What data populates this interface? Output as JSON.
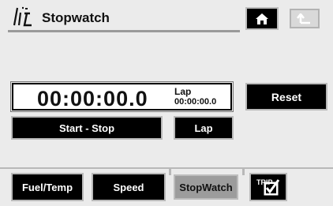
{
  "header": {
    "title": "Stopwatch",
    "logo_icon": "navigation-logo-icon",
    "home_icon": "home-icon",
    "back_icon": "back-arrow-icon"
  },
  "display": {
    "time": "00:00:00.0",
    "lap_label": "Lap",
    "lap_time": "00:00:00.0"
  },
  "buttons": {
    "reset": "Reset",
    "start_stop": "Start - Stop",
    "lap": "Lap"
  },
  "tabs": [
    {
      "label": "Fuel/Temp",
      "active": false
    },
    {
      "label": "Speed",
      "active": false
    },
    {
      "label": "StopWatch",
      "active": true
    },
    {
      "label": "TRIP",
      "icon": "trip-check-icon",
      "active": false
    }
  ],
  "colors": {
    "background": "#ebebeb",
    "button": "#000000",
    "active_tab": "#9c9c9c"
  }
}
